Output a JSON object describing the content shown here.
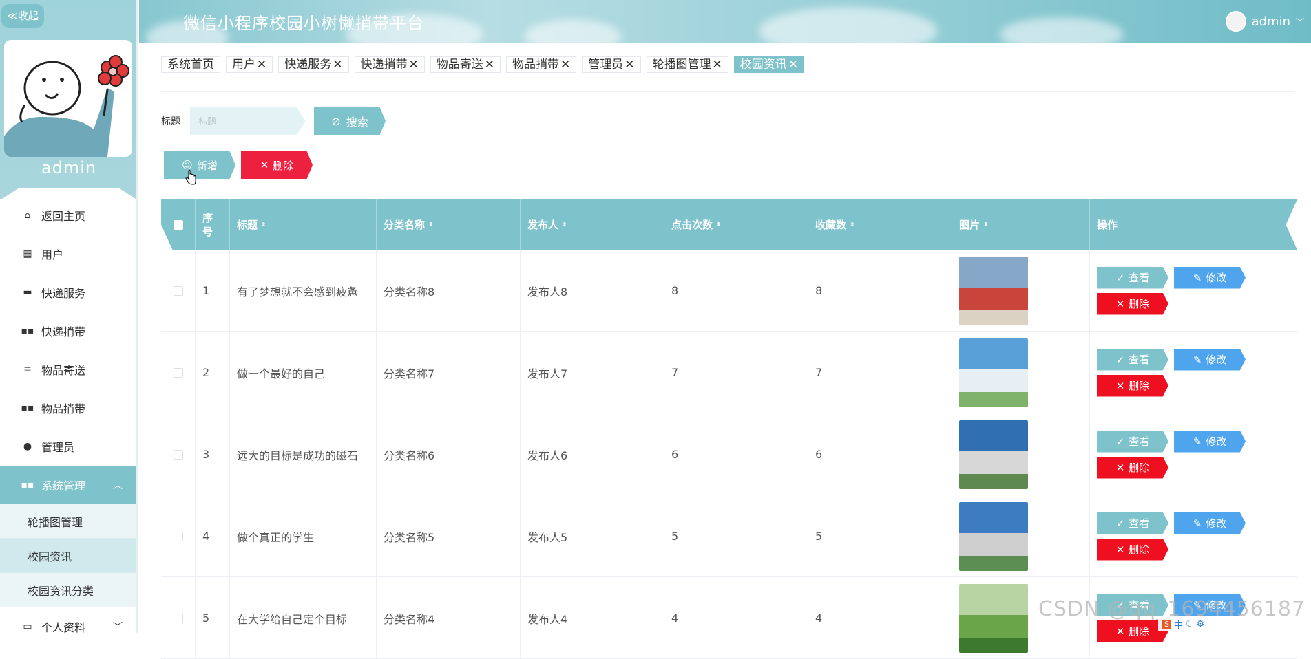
{
  "app": {
    "title": "微信小程序校园小树懒捎带平台",
    "collapse_label": "≪收起",
    "user_name": "admin"
  },
  "sidebar": {
    "user": "admin",
    "menu": [
      {
        "label": "返回主页",
        "icon": "home-icon"
      },
      {
        "label": "用户",
        "icon": "grid-icon"
      },
      {
        "label": "快递服务",
        "icon": "briefcase-icon"
      },
      {
        "label": "快递捎带",
        "icon": "grid-icon"
      },
      {
        "label": "物品寄送",
        "icon": "list-icon"
      },
      {
        "label": "物品捎带",
        "icon": "grid-icon"
      },
      {
        "label": "管理员",
        "icon": "bulb-icon"
      },
      {
        "label": "系统管理",
        "icon": "grid-icon"
      }
    ],
    "submenu": [
      "轮播图管理",
      "校园资讯",
      "校园资讯分类"
    ],
    "profile": {
      "label": "个人资料",
      "icon": "card-icon"
    }
  },
  "tags": [
    {
      "label": "系统首页",
      "closable": false
    },
    {
      "label": "用户",
      "closable": true
    },
    {
      "label": "快递服务",
      "closable": true
    },
    {
      "label": "快递捎带",
      "closable": true
    },
    {
      "label": "物品寄送",
      "closable": true
    },
    {
      "label": "物品捎带",
      "closable": true
    },
    {
      "label": "管理员",
      "closable": true
    },
    {
      "label": "轮播图管理",
      "closable": true
    },
    {
      "label": "校园资讯",
      "closable": true,
      "active": true
    }
  ],
  "search": {
    "label": "标题",
    "placeholder": "标题",
    "button": "搜索"
  },
  "actions": {
    "add": "新增",
    "delete": "删除"
  },
  "table": {
    "headers": [
      "序号",
      "标题",
      "分类名称",
      "发布人",
      "点击次数",
      "收藏数",
      "图片",
      "操作"
    ],
    "rows": [
      {
        "no": "1",
        "title": "有了梦想就不会感到疲惫",
        "category": "分类名称8",
        "publisher": "发布人8",
        "clicks": "8",
        "favorites": "8"
      },
      {
        "no": "2",
        "title": "做一个最好的自己",
        "category": "分类名称7",
        "publisher": "发布人7",
        "clicks": "7",
        "favorites": "7"
      },
      {
        "no": "3",
        "title": "远大的目标是成功的磁石",
        "category": "分类名称6",
        "publisher": "发布人6",
        "clicks": "6",
        "favorites": "6"
      },
      {
        "no": "4",
        "title": "做个真正的学生",
        "category": "分类名称5",
        "publisher": "发布人5",
        "clicks": "5",
        "favorites": "5"
      },
      {
        "no": "5",
        "title": "在大学给自己定个目标",
        "category": "分类名称4",
        "publisher": "发布人4",
        "clicks": "4",
        "favorites": "4"
      }
    ],
    "op_view": "查看",
    "op_edit": "修改",
    "op_delete": "删除"
  },
  "watermark": "CSDN @qq_1694456187",
  "ime": "中"
}
